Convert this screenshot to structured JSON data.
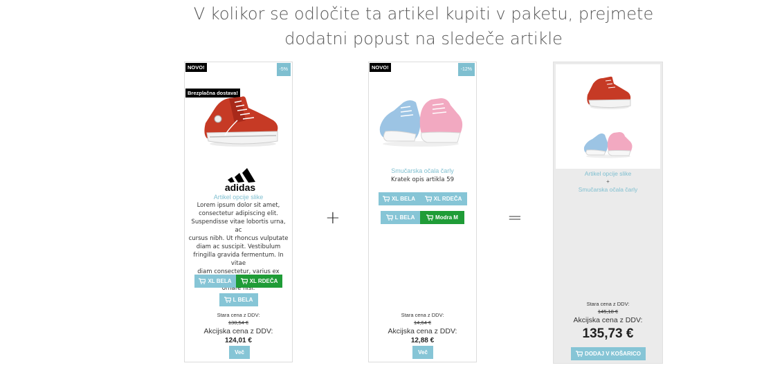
{
  "header": {
    "line1": "V kolikor se odločite ta artikel kupiti v paketu, prejmete",
    "line2": "dodatni popust na sledeče artikle"
  },
  "product1": {
    "badge_new": "NOVO!",
    "badge_discount": "-5%",
    "badge_shipping": "Brezplačna dostava!",
    "image_icon": "red-sneaker-image",
    "brand_logo": "adidas-logo",
    "brand_name": "adidas",
    "title": "Artikel opcije slike",
    "description": [
      "Lorem ipsum dolor sit amet,",
      "consectetur adipiscing elit.",
      "Suspendisse vitae lobortis urna, ac",
      "cursus nibh. Ut rhoncus vulputate",
      "diam ac suscipit. Vestibulum",
      "fringilla gravida fermentum. In vitae",
      "diam consectetur, varius ex lacinia,",
      "ornare nisi."
    ],
    "options_row1": [
      {
        "label": "XL BELA",
        "selected": false
      },
      {
        "label": "XL RDEČA",
        "selected": true
      }
    ],
    "options_row2": [
      {
        "label": "L BELA",
        "selected": false
      }
    ],
    "old_price_label": "Stara cena z DDV:",
    "old_price": "130,54 €",
    "sale_price_label": "Akcijska cena z DDV:",
    "sale_price": "124,01 €",
    "more_button": "Več"
  },
  "plus_sign": "+",
  "equals_sign": "=",
  "product2": {
    "badge_new": "NOVO!",
    "badge_discount": "-12%",
    "image_icon": "baby-shoes-image",
    "title": "Smučarska očala čarly",
    "short_desc": "Kratek opis artikla 59",
    "options_row1": [
      {
        "label": "XL BELA",
        "selected": false
      },
      {
        "label": "XL RDEČA",
        "selected": false
      }
    ],
    "options_row2": [
      {
        "label": "L BELA",
        "selected": false
      },
      {
        "label": "Modra M",
        "selected": true
      }
    ],
    "old_price_label": "Stara cena z DDV:",
    "old_price": "14,64 €",
    "sale_price_label": "Akcijska cena z DDV:",
    "sale_price": "12,88 €",
    "more_button": "Več"
  },
  "bundle": {
    "item1": "Artikel opcije slike",
    "plus": "+",
    "item2": "Smučarska očala čarly",
    "old_price_label": "Stara cena z DDV:",
    "old_price": "145,18 €",
    "sale_price_label": "Akcijska cena z DDV:",
    "sale_price": "135,73 €",
    "add_to_cart": "DODAJ V KOŠARICO"
  },
  "colors": {
    "accent": "#86c5d6",
    "link": "#7fbfd0",
    "selected": "#1f9c37"
  }
}
